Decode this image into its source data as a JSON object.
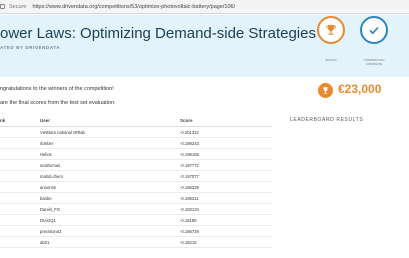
{
  "browser": {
    "secure_label": "Secure",
    "url": "https://www.drivendata.org/competitions/53/optimize-photovoltaic-battery/page/106/"
  },
  "hero": {
    "title": "ower Laws: Optimizing Demand-side Strategies",
    "subtitle": "ATED BY DRIVENDATA"
  },
  "badges": {
    "prize_label": "$23,000",
    "complete_label": "COMPETITION COMPLETE"
  },
  "prize": {
    "amount": "€23,000"
  },
  "content": {
    "congrats": "ngratulations to the winners of the competition!",
    "final_scores": "are the final scores from the test set evaluation:"
  },
  "leaderboard": {
    "title": "LEADERBOARD RESULTS",
    "columns": [
      "nk",
      "User",
      "Score"
    ],
    "rows": [
      {
        "rank": "",
        "user": "VietNam national ORlab",
        "score": "-0.201322"
      },
      {
        "rank": "",
        "user": "rbmber",
        "score": "-0.198243"
      },
      {
        "rank": "",
        "user": "Helios",
        "score": "-0.198155"
      },
      {
        "rank": "",
        "user": "scathomas",
        "score": "-0.197772"
      },
      {
        "rank": "",
        "user": "mahdi.chem",
        "score": "-0.197077"
      },
      {
        "rank": "",
        "user": "anoonne",
        "score": "-0.195328"
      },
      {
        "rank": "",
        "user": "banbe",
        "score": "-0.195311"
      },
      {
        "rank": "",
        "user": "Daniel_FG",
        "score": "-0.183134"
      },
      {
        "rank": "",
        "user": "DIAGQ1",
        "score": "-0.18185"
      },
      {
        "rank": "",
        "user": "precision42",
        "score": "-0.166729"
      },
      {
        "rank": "",
        "user": "ab01",
        "score": "-0.16215"
      }
    ]
  },
  "colors": {
    "accent_orange": "#e88b2f",
    "accent_blue": "#2e86c1",
    "hero_bg": "#e3f3fb"
  }
}
